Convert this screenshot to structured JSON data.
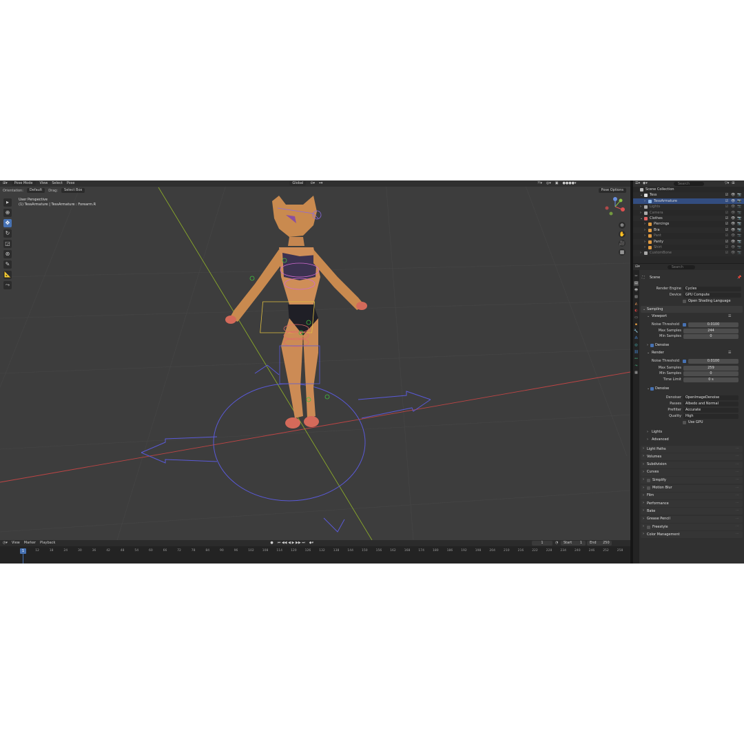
{
  "viewport": {
    "mode": "Pose Mode",
    "menus": [
      "View",
      "Select",
      "Pose"
    ],
    "orientation_label": "Orientation:",
    "orientation_value": "Default",
    "drag_label": "Drag:",
    "drag_value": "Select Box",
    "transform": "Global",
    "pose_options": "Pose Options",
    "overlay_line1": "User Perspective",
    "overlay_line2": "(1) TessArmature | TessArmature : Forearm.R"
  },
  "timeline": {
    "menus": [
      "View",
      "Marker",
      "Playback"
    ],
    "current_frame": "1",
    "start_label": "Start",
    "start_value": "1",
    "end_label": "End",
    "end_value": "250",
    "ruler": [
      "1",
      "6",
      "12",
      "18",
      "24",
      "30",
      "36",
      "42",
      "48",
      "54",
      "60",
      "66",
      "72",
      "78",
      "84",
      "90",
      "96",
      "102",
      "108",
      "114",
      "120",
      "126",
      "132",
      "138",
      "144",
      "150",
      "156",
      "162",
      "168",
      "174",
      "180",
      "186",
      "192",
      "198",
      "204",
      "210",
      "216",
      "222",
      "228",
      "234",
      "240",
      "246",
      "252",
      "258"
    ]
  },
  "outliner": {
    "search_placeholder": "Search",
    "rows": [
      {
        "name": "Scene Collection",
        "indent": 0,
        "dim": false,
        "selected": false,
        "color": "#bbbbbb"
      },
      {
        "name": "Tess",
        "indent": 1,
        "dim": false,
        "selected": false,
        "color": "#e0e0e0"
      },
      {
        "name": "TessArmature",
        "indent": 2,
        "dim": false,
        "selected": true,
        "color": "#8fb8e8"
      },
      {
        "name": "Lights",
        "indent": 1,
        "dim": true,
        "selected": false,
        "color": "#aaaaaa"
      },
      {
        "name": "Camera",
        "indent": 1,
        "dim": true,
        "selected": false,
        "color": "#aaaaaa"
      },
      {
        "name": "Clothes",
        "indent": 1,
        "dim": false,
        "selected": false,
        "color": "#e06060"
      },
      {
        "name": "Piercings",
        "indent": 2,
        "dim": false,
        "selected": false,
        "color": "#e09a40"
      },
      {
        "name": "Bra",
        "indent": 2,
        "dim": false,
        "selected": false,
        "color": "#e09a40"
      },
      {
        "name": "Pant",
        "indent": 2,
        "dim": true,
        "selected": false,
        "color": "#e09a40"
      },
      {
        "name": "Panty",
        "indent": 2,
        "dim": false,
        "selected": false,
        "color": "#e09a40"
      },
      {
        "name": "Shirt",
        "indent": 2,
        "dim": true,
        "selected": false,
        "color": "#e09a40"
      },
      {
        "name": "CustomBone",
        "indent": 1,
        "dim": true,
        "selected": false,
        "color": "#aaaaaa"
      }
    ]
  },
  "properties": {
    "search_placeholder": "Search",
    "context": "Scene",
    "render_engine_label": "Render Engine",
    "render_engine": "Cycles",
    "device_label": "Device",
    "device": "GPU Compute",
    "osl_label": "Open Shading Language",
    "sampling": "Sampling",
    "viewport": "Viewport",
    "vp_noise_label": "Noise Threshold",
    "vp_noise": "0.0100",
    "vp_max_label": "Max Samples",
    "vp_max": "244",
    "vp_min_label": "Min Samples",
    "vp_min": "0",
    "vp_denoise": "Denoise",
    "render": "Render",
    "r_noise_label": "Noise Threshold",
    "r_noise": "0.0100",
    "r_max_label": "Max Samples",
    "r_max": "259",
    "r_min_label": "Min Samples",
    "r_min": "0",
    "r_time_label": "Time Limit",
    "r_time": "0 s",
    "r_denoise": "Denoise",
    "denoiser_label": "Denoiser",
    "denoiser": "OpenImageDenoise",
    "passes_label": "Passes",
    "passes": "Albedo and Normal",
    "prefilter_label": "Prefilter",
    "prefilter": "Accurate",
    "quality_label": "Quality",
    "quality": "High",
    "use_gpu": "Use GPU",
    "lights": "Lights",
    "advanced": "Advanced",
    "panels": [
      "Light Paths",
      "Volumes",
      "Subdivision",
      "Curves",
      "Simplify",
      "Motion Blur",
      "Film",
      "Performance",
      "Bake",
      "Grease Pencil",
      "Freestyle",
      "Color Management"
    ]
  },
  "colors": {
    "accent": "#4772b3",
    "x_axis": "#c04545",
    "y_axis": "#8aaa2a",
    "bone_blue": "#5a5ad8",
    "skin": "#d4925c",
    "select_yellow": "#e0c040"
  }
}
